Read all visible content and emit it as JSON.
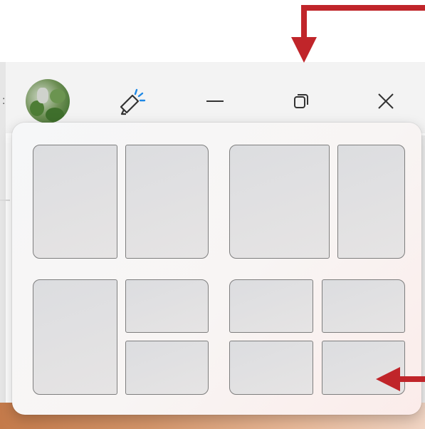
{
  "titlebar": {
    "overflow_glyph": ":",
    "avatar": "avatar-photo",
    "buttons": [
      {
        "name": "celebrate",
        "icon": "megaphone-icon"
      },
      {
        "name": "minimize",
        "icon": "minimize-icon"
      },
      {
        "name": "restore",
        "icon": "restore-icon"
      },
      {
        "name": "close",
        "icon": "close-icon"
      }
    ]
  },
  "snap_layouts": {
    "layouts": [
      {
        "name": "two-equal-columns",
        "zones": 2
      },
      {
        "name": "two-columns-wide-left",
        "zones": 2
      },
      {
        "name": "left-column-right-split",
        "zones": 3
      },
      {
        "name": "four-quadrants",
        "zones": 4
      }
    ],
    "highlighted_zone": "four-quadrants-bottom-right"
  },
  "annotations": {
    "arrow_color": "#c0252a",
    "arrows": [
      "arrow-to-restore-button",
      "arrow-to-snap-zone"
    ]
  },
  "colors": {
    "titlebar_bg": "#f3f3f3",
    "flyout_bg": "#f7f6f6",
    "zone_fill": "#e0e0e2",
    "zone_border": "#7e7e7e",
    "accent_arrow": "#c0252a"
  }
}
